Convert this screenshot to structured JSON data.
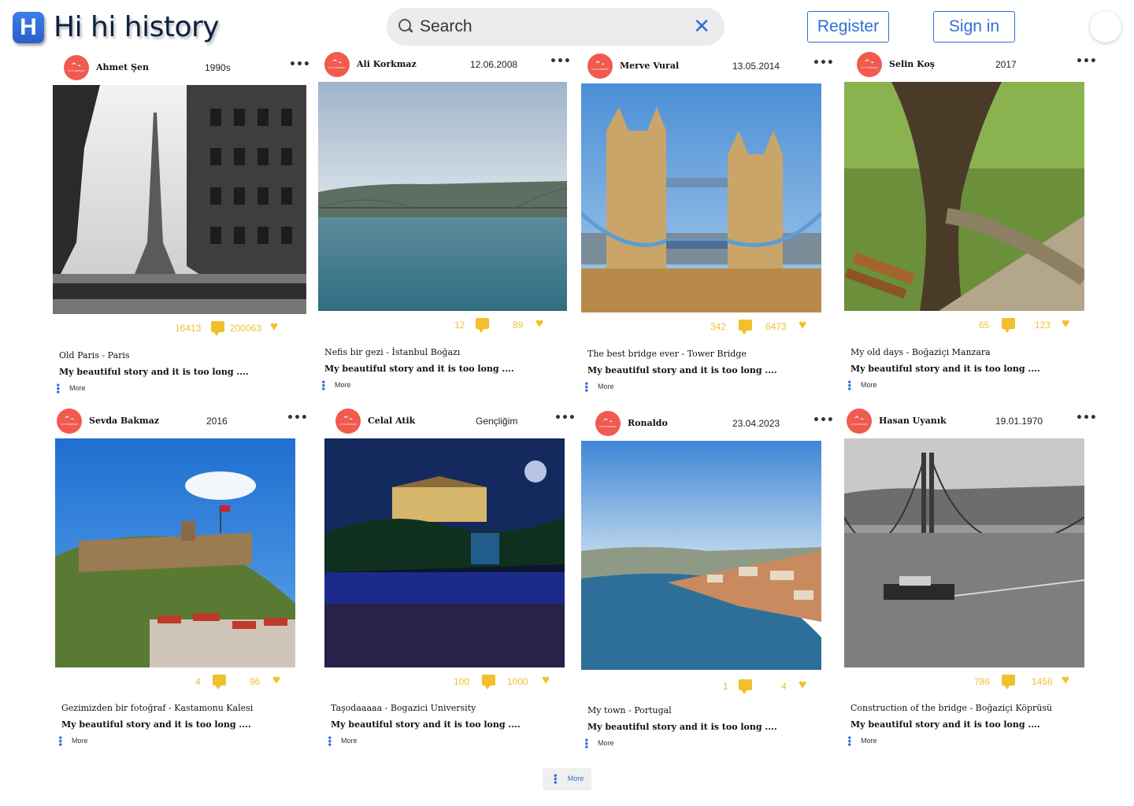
{
  "app": {
    "logo_letter": "H",
    "logo_text": "Hi hi history"
  },
  "search": {
    "placeholder": "Search",
    "clear_symbol": "✕"
  },
  "header": {
    "register_label": "Register",
    "signin_label": "Sign in"
  },
  "common": {
    "story_preview": "My beautiful story and it is too long ....",
    "more_label": "More",
    "menu_symbol": "•••",
    "avatar_mark": "^-",
    "avatar_text": "HI HI HISTORY"
  },
  "colors": {
    "accent_blue": "#2f6fd6",
    "stat_yellow": "#f2c02d",
    "avatar_red": "#f15a4e"
  },
  "posts": [
    {
      "author": "Ahmet Şen",
      "date": "1990s",
      "comments": "16413",
      "likes": "200063",
      "title": "Old Paris - Paris",
      "image": "paris-street-bw"
    },
    {
      "author": "Ali Korkmaz",
      "date": "12.06.2008",
      "comments": "12",
      "likes": "89",
      "title": "Nefis bir gezi - İstanbul Boğazı",
      "image": "bosphorus-bridge"
    },
    {
      "author": "Merve Vural",
      "date": "13.05.2014",
      "comments": "342",
      "likes": "6473",
      "title": "The best bridge ever - Tower Bridge",
      "image": "tower-bridge"
    },
    {
      "author": "Selin Koş",
      "date": "2017",
      "comments": "65",
      "likes": "123",
      "title": "My old days - Boğaziçi Manzara",
      "image": "park-tree-bench"
    },
    {
      "author": "Sevda Bakmaz",
      "date": "2016",
      "comments": "4",
      "likes": "96",
      "title": "Gezimizden bir fotoğraf - Kastamonu Kalesi",
      "image": "castle-hill"
    },
    {
      "author": "Celal Atik",
      "date": "Gençliğim",
      "comments": "100",
      "likes": "1000",
      "title": "Taşodaaaaa - Bogazici University",
      "image": "night-concert"
    },
    {
      "author": "Ronaldo",
      "date": "23.04.2023",
      "comments": "1",
      "likes": "4",
      "title": "My town - Portugal",
      "image": "porto-river"
    },
    {
      "author": "Hasan Uyanık",
      "date": "19.01.1970",
      "comments": "786",
      "likes": "1456",
      "title": "Construction of the bridge - Boğaziçi Köprüsü",
      "image": "bridge-construction-bw"
    }
  ],
  "footer": {
    "more_label": "More"
  }
}
